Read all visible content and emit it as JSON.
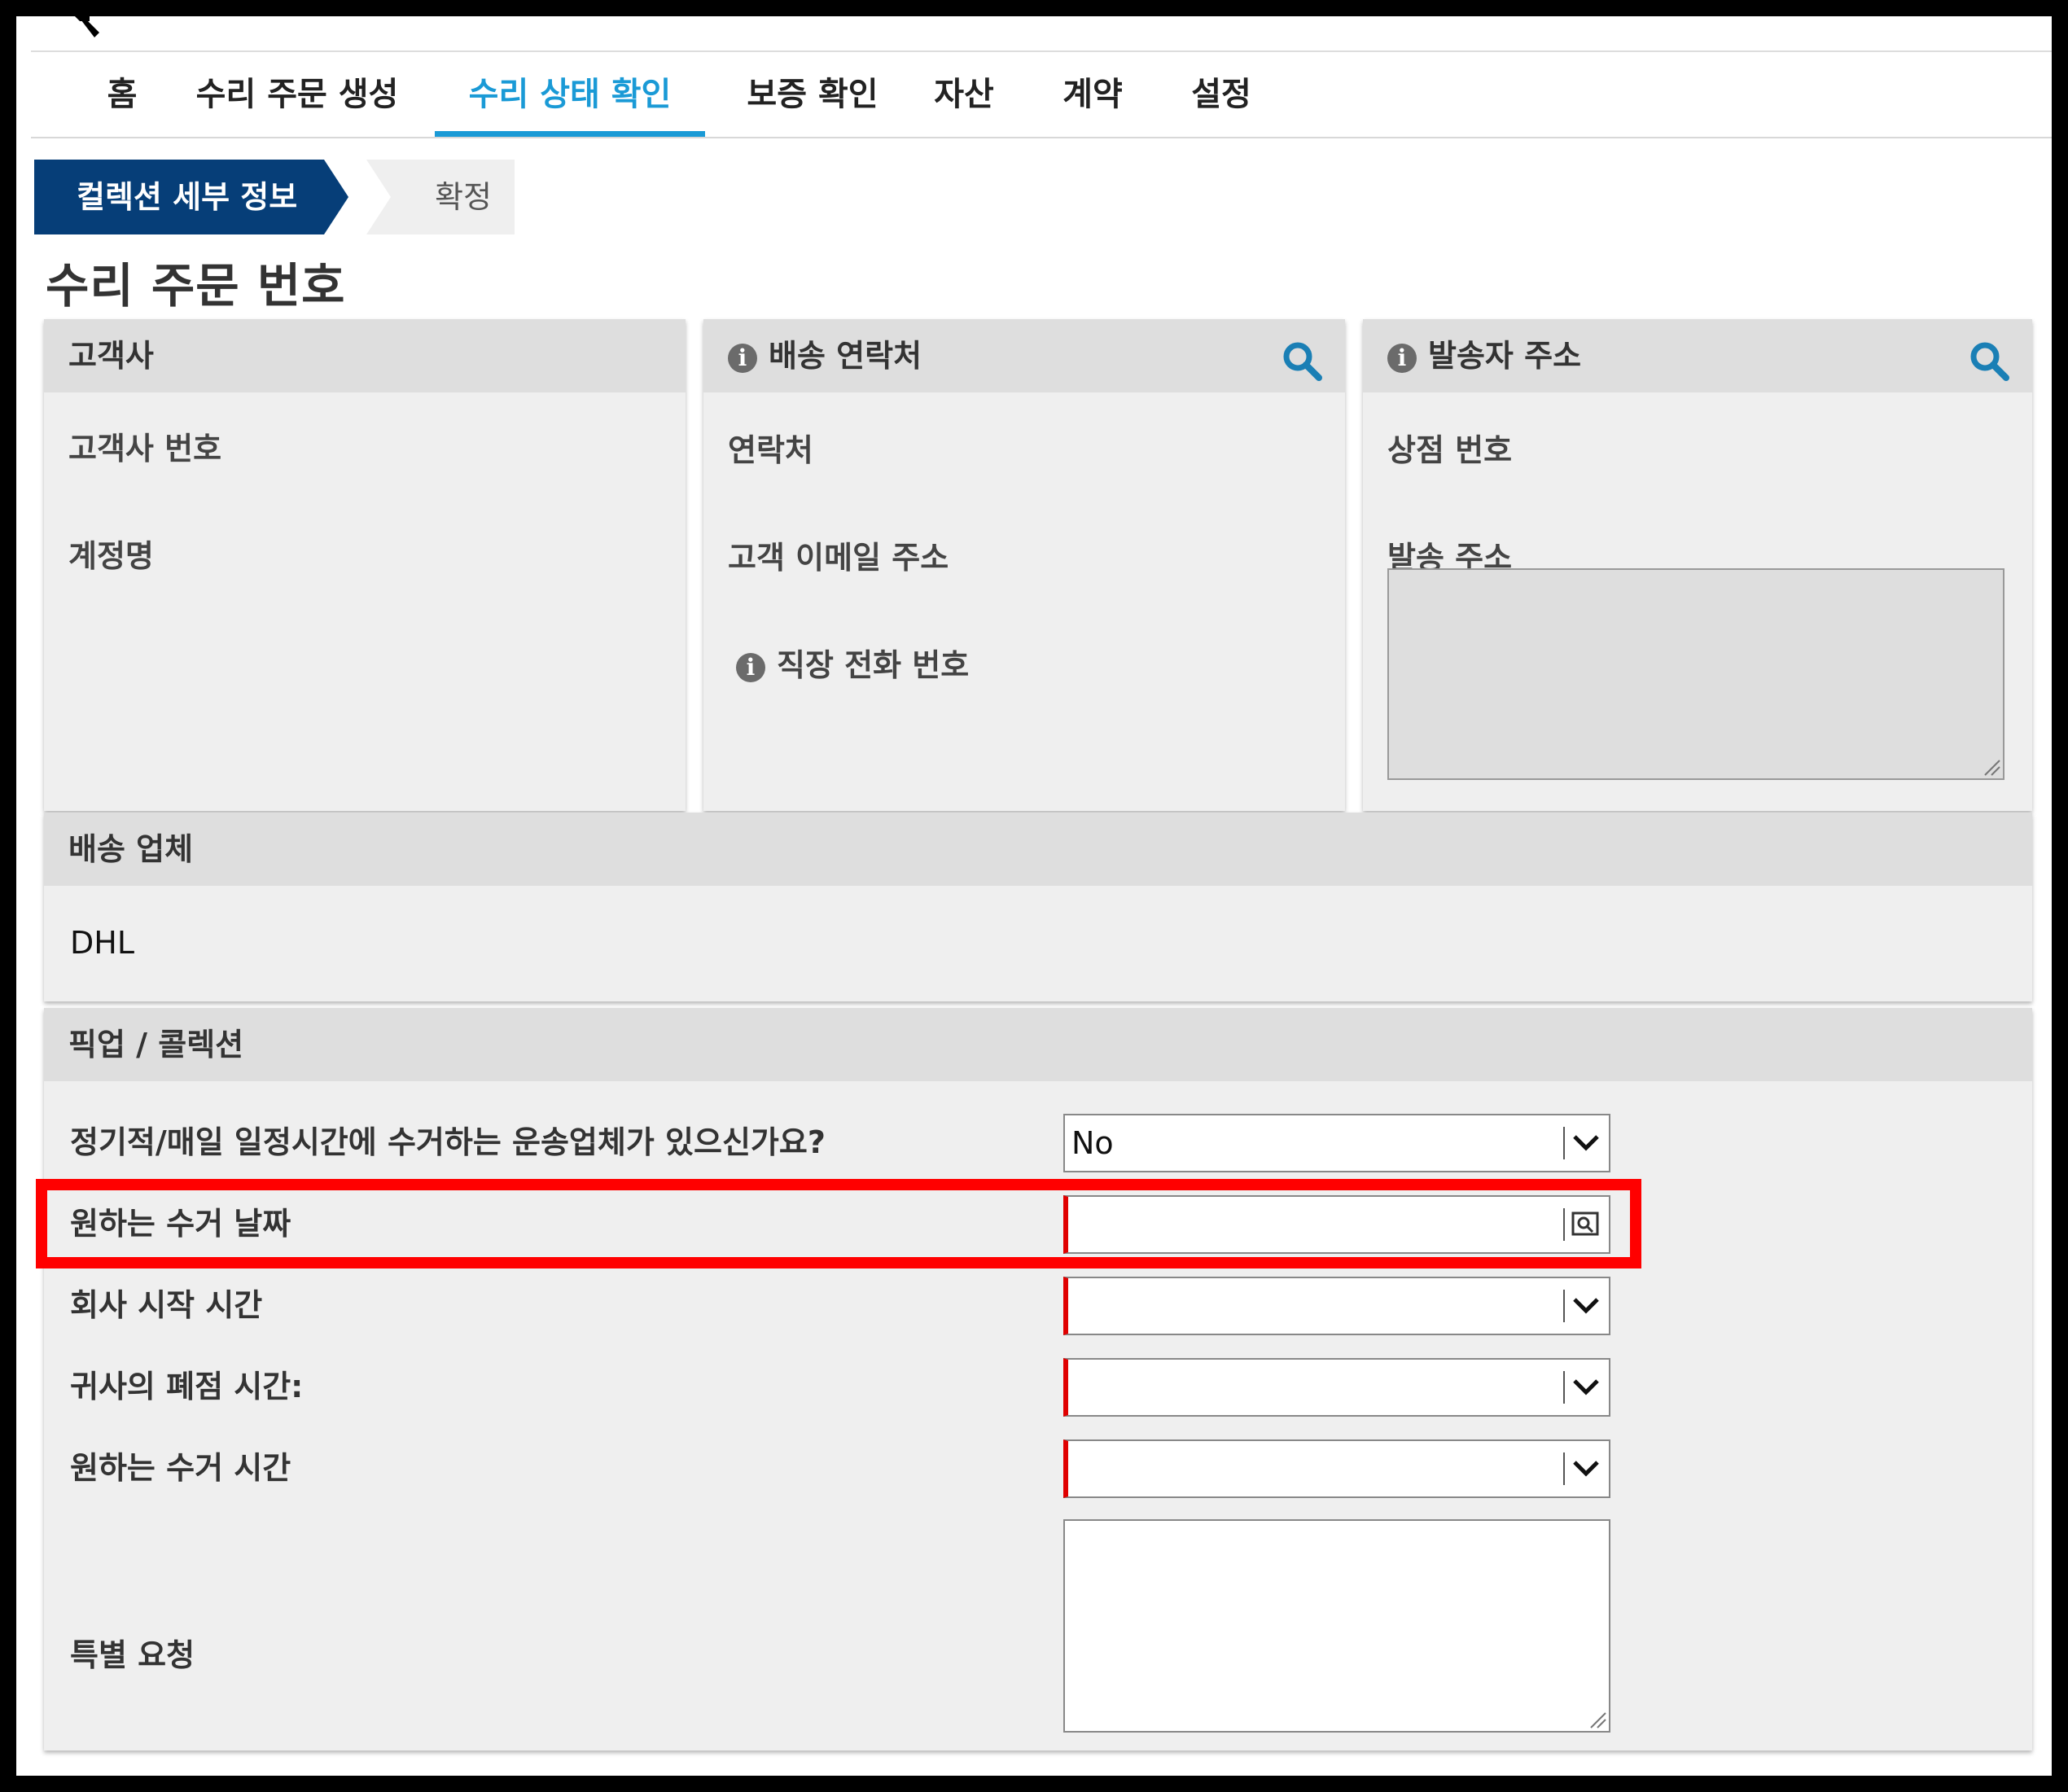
{
  "nav": {
    "tabs": [
      {
        "label": "홈"
      },
      {
        "label": "수리 주문 생성"
      },
      {
        "label": "수리 상태 확인"
      },
      {
        "label": "보증 확인"
      },
      {
        "label": "자산"
      },
      {
        "label": "계약"
      },
      {
        "label": "설정"
      }
    ],
    "active_tab": "수리 상태 확인"
  },
  "steps": {
    "current": "컬렉션 세부 정보",
    "next": "확정"
  },
  "page_title": "수리 주문 번호",
  "panels": {
    "customer": {
      "title": "고객사",
      "fields": [
        "고객사 번호",
        "계정명"
      ]
    },
    "shipping_contact": {
      "title": "배송 연락처",
      "fields": [
        "연락처",
        "고객 이메일 주소",
        "직장 전화 번호"
      ]
    },
    "sender_address": {
      "title": "발송자 주소",
      "fields": [
        "상점 번호",
        "발송 주소"
      ],
      "address_value": ""
    },
    "carrier": {
      "title": "배송 업체",
      "value": "DHL"
    },
    "pickup": {
      "title": "픽업 / 콜렉션",
      "questions": {
        "scheduled_pickup": {
          "label": "정기적/매일 일정시간에 수거하는 운송업체가 있으신가요?",
          "value": "No"
        },
        "preferred_date": {
          "label": "원하는 수거 날짜",
          "value": ""
        },
        "company_open": {
          "label": "회사 시작 시간",
          "value": ""
        },
        "company_close": {
          "label": "귀사의 폐점 시간:",
          "value": ""
        },
        "preferred_time": {
          "label": "원하는 수거 시간",
          "value": ""
        },
        "special_request": {
          "label": "특별 요청",
          "value": ""
        }
      }
    }
  },
  "colors": {
    "accent": "#1a9ad6",
    "step_active": "#063e78",
    "required": "#e00000",
    "highlight": "#ff0000"
  }
}
